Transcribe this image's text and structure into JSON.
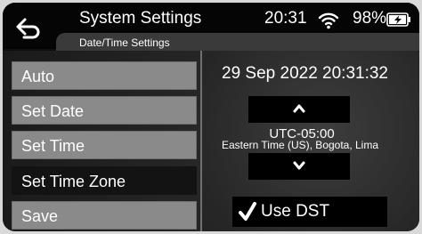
{
  "header": {
    "title": "System Settings",
    "subtitle": "Date/Time Settings",
    "time": "20:31",
    "battery": "98%"
  },
  "icons": {
    "back": "back-arrow-icon",
    "wifi": "wifi-icon",
    "battery": "battery-charging-icon",
    "up": "chevron-up-icon",
    "down": "chevron-down-icon",
    "check": "checkmark-icon"
  },
  "menu": {
    "items": [
      {
        "label": "Auto"
      },
      {
        "label": "Set Date"
      },
      {
        "label": "Set Time"
      },
      {
        "label": "Set Time Zone",
        "selected": true
      },
      {
        "label": "Save"
      }
    ]
  },
  "panel": {
    "datetime": "29 Sep 2022 20:31:32",
    "tz_offset": "UTC-05:00",
    "tz_name": "Eastern Time (US), Bogota, Lima",
    "use_dst_label": "Use DST",
    "use_dst_checked": true
  },
  "colors": {
    "button": "#8a8a8a",
    "selected": "#131313",
    "header": "#050505"
  }
}
